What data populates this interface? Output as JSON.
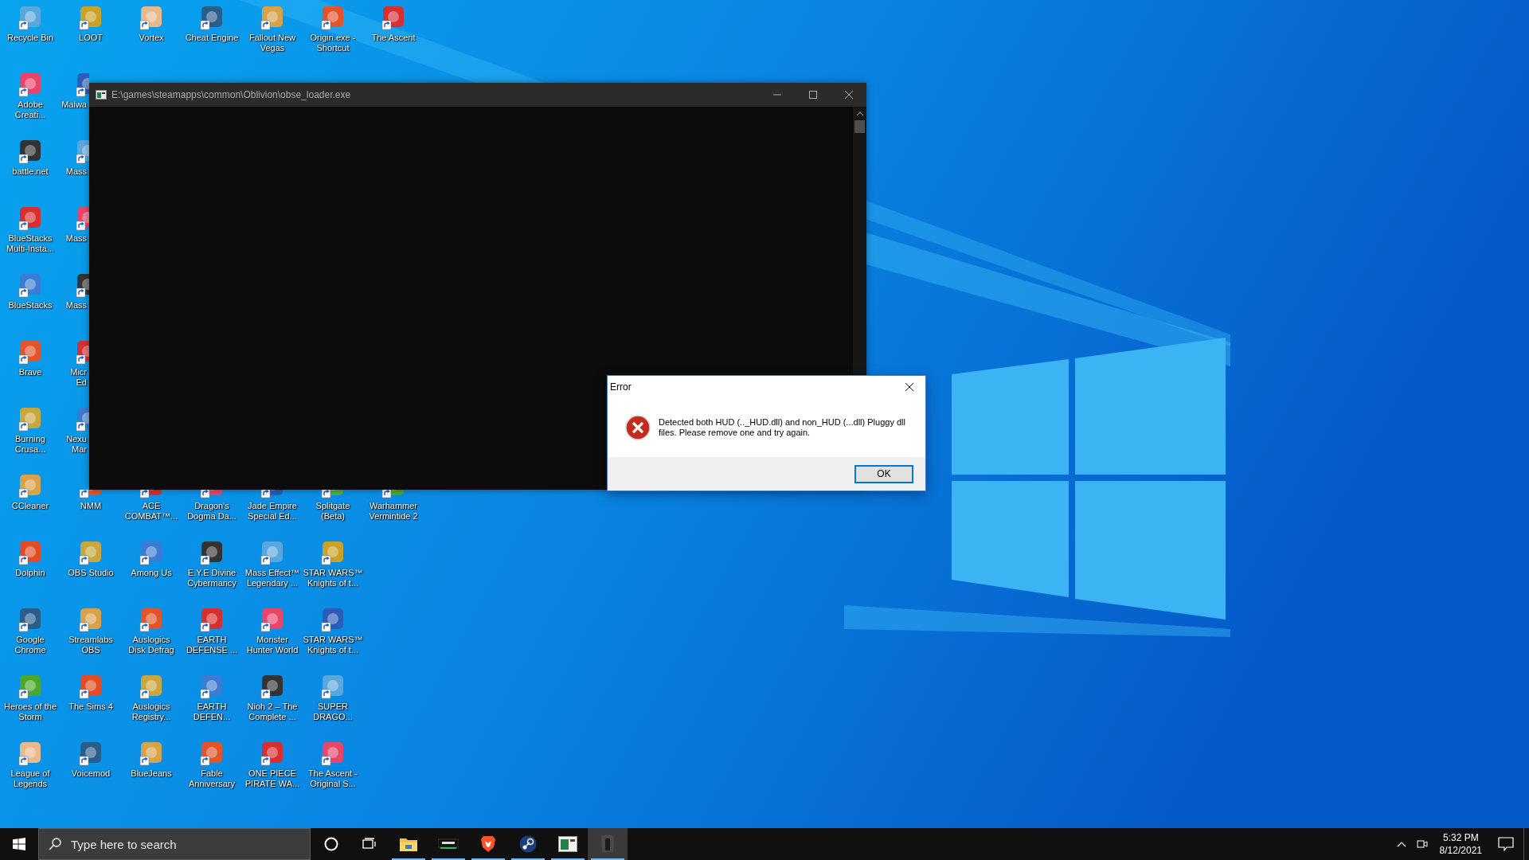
{
  "desktop_icon_rows": [
    [
      {
        "label": "Recycle Bin"
      },
      {
        "label": "LOOT"
      },
      {
        "label": "Vortex"
      },
      {
        "label": "Cheat Engine"
      },
      {
        "label": "Fallout New\nVegas"
      },
      {
        "label": "Origin.exe -\nShortcut"
      },
      {
        "label": "The Ascent"
      }
    ],
    [
      {
        "label": "Adobe\nCreati..."
      },
      {
        "label": "Malwa"
      }
    ],
    [
      {
        "label": "battle.net"
      },
      {
        "label": "Mass"
      }
    ],
    [
      {
        "label": "BlueStacks\nMulti-Insta..."
      },
      {
        "label": "Mass"
      }
    ],
    [
      {
        "label": "BlueStacks"
      },
      {
        "label": "Mass"
      }
    ],
    [
      {
        "label": "Brave"
      },
      {
        "label": "Micr\nEd"
      }
    ],
    [
      {
        "label": "Burning\nCrusa..."
      },
      {
        "label": "Nexu\nMar"
      }
    ],
    [
      {
        "label": "CCleaner"
      },
      {
        "label": "NMM"
      },
      {
        "label": "ACE\nCOMBAT™..."
      },
      {
        "label": "Dragon's\nDogma Da..."
      },
      {
        "label": "Jade Empire\nSpecial Ed..."
      },
      {
        "label": "Splitgate\n(Beta)"
      },
      {
        "label": "Warhammer\nVermintide 2"
      }
    ],
    [
      {
        "label": "Dolphin"
      },
      {
        "label": "OBS Studio"
      },
      {
        "label": "Among Us"
      },
      {
        "label": "E.Y.E Divine\nCybermancy"
      },
      {
        "label": "Mass Effect™\nLegendary ..."
      },
      {
        "label": "STAR WARS™\nKnights of t..."
      }
    ],
    [
      {
        "label": "Google\nChrome"
      },
      {
        "label": "Streamlabs\nOBS"
      },
      {
        "label": "Auslogics\nDisk Defrag"
      },
      {
        "label": "EARTH\nDEFENSE ..."
      },
      {
        "label": "Monster\nHunter World"
      },
      {
        "label": "STAR WARS™\nKnights of t..."
      }
    ],
    [
      {
        "label": "Heroes of the\nStorm"
      },
      {
        "label": "The Sims 4"
      },
      {
        "label": "Auslogics\nRegistry..."
      },
      {
        "label": "EARTH\nDEFEN..."
      },
      {
        "label": "Nioh 2 – The\nComplete ..."
      },
      {
        "label": "SUPER\nDRAGO..."
      }
    ],
    [
      {
        "label": "League of\nLegends"
      },
      {
        "label": "Voicemod"
      },
      {
        "label": "BlueJeans"
      },
      {
        "label": "Fable\nAnniversary"
      },
      {
        "label": "ONE PIECE\nPIRATE WA..."
      },
      {
        "label": "The Ascent -\nOriginal S..."
      }
    ]
  ],
  "console_window": {
    "title": "E:\\games\\steamapps\\common\\Oblivion\\obse_loader.exe"
  },
  "error_dialog": {
    "title": "Error",
    "message": "Detected both HUD (.._HUD.dll) and non_HUD (...dll) Pluggy dll files. Please remove one and try again.",
    "buttons": [
      "OK"
    ]
  },
  "taskbar": {
    "search": {
      "placeholder": "Type here to search"
    },
    "apps": [
      {
        "running": true,
        "selected": false
      },
      {
        "running": true,
        "selected": false
      },
      {
        "running": true,
        "selected": false
      },
      {
        "running": true,
        "selected": false
      },
      {
        "running": true,
        "selected": false
      },
      {
        "running": true,
        "selected": true
      }
    ],
    "clock": {
      "time": "5:32 PM",
      "date": "8/12/2021"
    }
  }
}
